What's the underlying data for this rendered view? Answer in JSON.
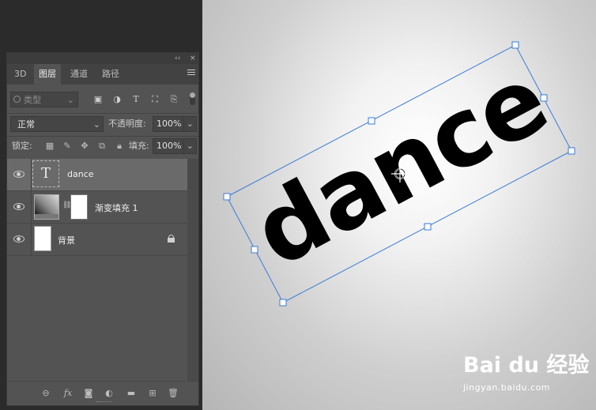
{
  "panel": {
    "collapse_glyph": "‹‹",
    "close_glyph": "×",
    "tabs": [
      {
        "label": "3D",
        "active": false
      },
      {
        "label": "图层",
        "active": true
      },
      {
        "label": "通道",
        "active": false
      },
      {
        "label": "路径",
        "active": false
      }
    ],
    "filter": {
      "placeholder": "类型",
      "icons": [
        "image-filter-icon",
        "adjustment-filter-icon",
        "type-filter-icon",
        "shape-filter-icon",
        "smart-object-filter-icon"
      ]
    },
    "blend_mode": "正常",
    "opacity_label": "不透明度:",
    "opacity_value": "100%",
    "lock_label": "锁定:",
    "fill_label": "填充:",
    "fill_value": "100%",
    "layers": [
      {
        "name": "dance",
        "type": "text",
        "selected": true,
        "thumb_glyph": "T"
      },
      {
        "name": "渐变填充 1",
        "type": "gradient-fill",
        "selected": false
      },
      {
        "name": "背景",
        "type": "background",
        "selected": false,
        "locked": true
      }
    ],
    "bottom_icons": [
      "link-layers-icon",
      "fx-icon",
      "add-mask-icon",
      "new-adjustment-icon",
      "new-group-icon",
      "new-layer-icon",
      "delete-layer-icon"
    ]
  },
  "canvas": {
    "text": "dance",
    "text_color": "#000000",
    "bounding_box_color": "#3b7bd8",
    "background": "radial white-to-gray gradient"
  },
  "watermark": {
    "brand": "Bai du 经验",
    "url": "jingyan.baidu.com"
  }
}
